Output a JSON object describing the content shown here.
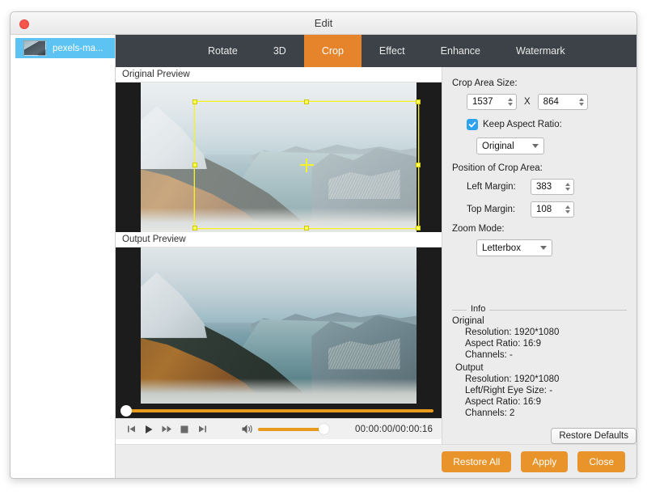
{
  "window": {
    "title": "Edit",
    "close_icon": "close-icon"
  },
  "sidebar": {
    "files": [
      {
        "name": "pexels-ma...",
        "thumb_icon": "video-thumbnail-icon"
      }
    ]
  },
  "tabs": [
    {
      "label": "Rotate",
      "active": false
    },
    {
      "label": "3D",
      "active": false
    },
    {
      "label": "Crop",
      "active": true
    },
    {
      "label": "Effect",
      "active": false
    },
    {
      "label": "Enhance",
      "active": false
    },
    {
      "label": "Watermark",
      "active": false
    }
  ],
  "previews": {
    "original_label": "Original Preview",
    "output_label": "Output Preview"
  },
  "transport": {
    "previous_icon": "skip-previous-icon",
    "play_icon": "play-icon",
    "forward_icon": "fast-forward-icon",
    "stop_icon": "stop-icon",
    "next_icon": "skip-next-icon",
    "volume_icon": "volume-icon",
    "time": "00:00:00/00:00:16"
  },
  "crop_panel": {
    "crop_area_size_label": "Crop Area Size:",
    "width_value": "1537",
    "x_separator": "X",
    "height_value": "864",
    "keep_aspect_ratio_label": "Keep Aspect Ratio:",
    "keep_aspect_ratio_checked": true,
    "aspect_ratio_value": "Original",
    "position_label": "Position of Crop Area:",
    "left_margin_label": "Left Margin:",
    "left_margin_value": "383",
    "top_margin_label": "Top Margin:",
    "top_margin_value": "108",
    "zoom_mode_label": "Zoom Mode:",
    "zoom_mode_value": "Letterbox"
  },
  "info": {
    "legend": "Info",
    "original_heading": "Original",
    "original_lines": [
      "Resolution: 1920*1080",
      "Aspect Ratio: 16:9",
      "Channels: -"
    ],
    "output_heading": "Output",
    "output_lines": [
      "Resolution: 1920*1080",
      "Left/Right Eye Size: -",
      "Aspect Ratio: 16:9",
      "Channels: 2"
    ],
    "restore_defaults_label": "Restore Defaults"
  },
  "footer": {
    "restore_all_label": "Restore All",
    "apply_label": "Apply",
    "close_label": "Close"
  },
  "colors": {
    "accent_orange": "#e8942a",
    "tab_active": "#e5842b",
    "tabbar_bg": "#3d4248",
    "selection_blue": "#5cc3f2",
    "checkbox_blue": "#2da3f0",
    "crop_outline": "#f5f227"
  }
}
